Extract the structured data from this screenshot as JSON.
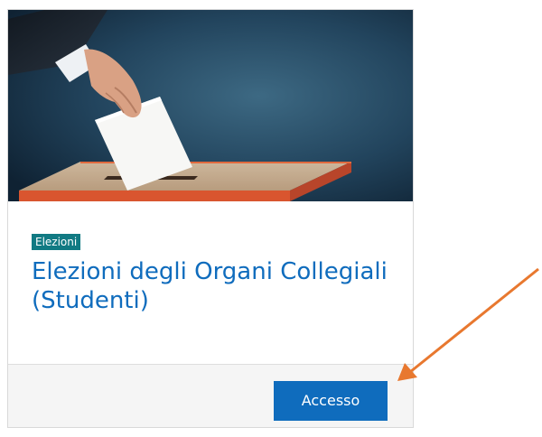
{
  "card": {
    "image_alt": "ballot-box-illustration",
    "category": "Elezioni",
    "title": "Elezioni degli Organi Collegiali (Studenti)",
    "action_label": "Accesso"
  },
  "colors": {
    "accent": "#0f6cbd",
    "badge": "#117a83",
    "annotation_arrow": "#e8782f"
  }
}
